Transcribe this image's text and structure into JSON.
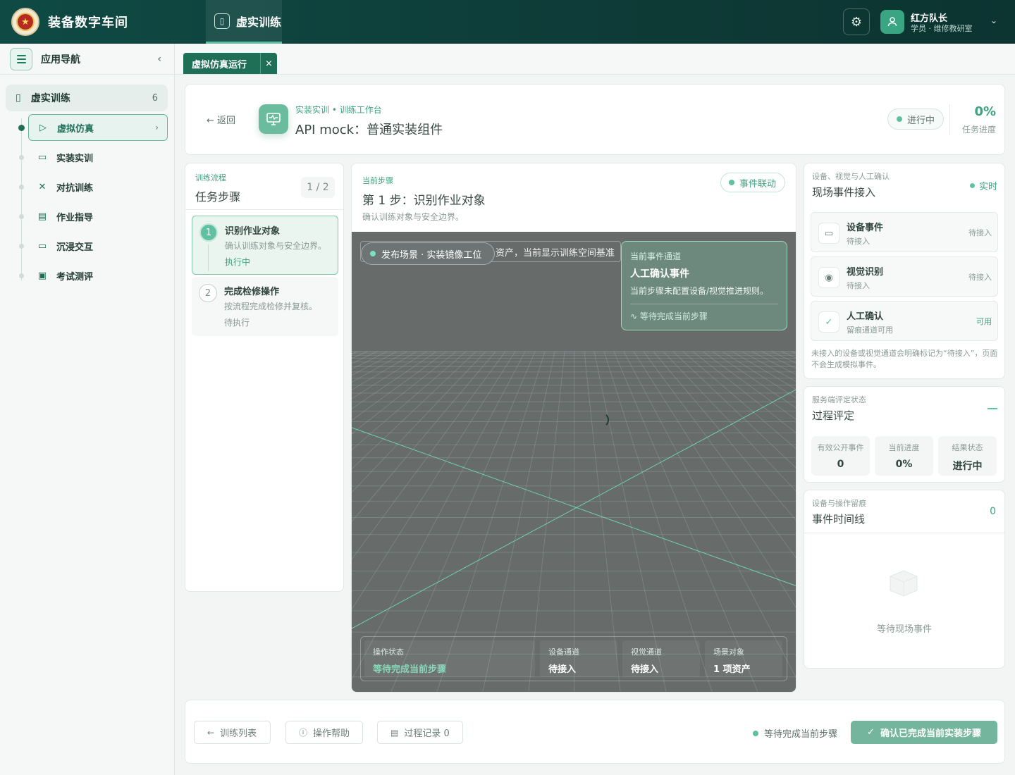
{
  "app": {
    "title": "装备数字车间",
    "logo_icon": "emblem-icon"
  },
  "topnav": {
    "label": "虚实训练"
  },
  "user": {
    "name": "红方队长",
    "subtitle": "学员 · 维修教研室"
  },
  "sidebar": {
    "title": "应用导航",
    "group": {
      "label": "虚实训练",
      "count": "6"
    },
    "items": [
      {
        "label": "虚拟仿真",
        "icon": "play-circle-icon",
        "active": true
      },
      {
        "label": "实装实训",
        "icon": "monitor-icon"
      },
      {
        "label": "对抗训练",
        "icon": "crossed-swords-icon"
      },
      {
        "label": "作业指导",
        "icon": "document-icon"
      },
      {
        "label": "沉浸交互",
        "icon": "vr-headset-icon"
      },
      {
        "label": "考试测评",
        "icon": "clipboard-check-icon"
      }
    ]
  },
  "tabs": [
    {
      "label": "虚拟仿真运行",
      "close": "×"
    }
  ],
  "header": {
    "back": "返回",
    "crumb": "实装实训 • 训练工作台",
    "title": "API mock：普通实装组件",
    "status": "进行中",
    "progress": "0%",
    "progress_label": "任务进度"
  },
  "flow": {
    "label": "训练流程",
    "title": "任务步骤",
    "counter": "1 / 2",
    "steps": [
      {
        "num": "1",
        "title": "识别作业对象",
        "desc": "确认训练对象与安全边界。",
        "state": "执行中"
      },
      {
        "num": "2",
        "title": "完成检修操作",
        "desc": "按流程完成检修并复核。",
        "state": "待执行"
      }
    ]
  },
  "main": {
    "label": "当前步骤",
    "title": "第 1 步：识别作业对象",
    "sub": "确认训练对象与安全边界。",
    "badge": "事件联动",
    "scene_banner": "资产，当前显示训练空间基准",
    "scene_pill": "发布场景 · 实装镜像工位",
    "event_card": {
      "label": "当前事件通道",
      "title": "人工确认事件",
      "desc": "当前步骤未配置设备/视觉推进规则。",
      "action": "等待完成当前步骤"
    },
    "status_bar": [
      {
        "key": "操作状态",
        "value": "等待完成当前步骤"
      },
      {
        "key": "设备通道",
        "value": "待接入"
      },
      {
        "key": "视觉通道",
        "value": "待接入"
      },
      {
        "key": "场景对象",
        "value": "1 项资产"
      }
    ]
  },
  "access": {
    "label": "设备、视觉与人工确认",
    "title": "现场事件接入",
    "live": "实时",
    "channels": [
      {
        "name": "设备事件",
        "status": "待接入",
        "right": "待接入",
        "icon": "monitor-icon"
      },
      {
        "name": "视觉识别",
        "status": "待接入",
        "right": "待接入",
        "icon": "eye-icon"
      },
      {
        "name": "人工确认",
        "status": "留痕通道可用",
        "right": "可用",
        "icon": "check-icon"
      }
    ],
    "note": "未接入的设备或视觉通道会明确标记为“待接入”，页面不会生成模拟事件。"
  },
  "evaluation": {
    "label": "服务端评定状态",
    "title": "过程评定",
    "stats": [
      {
        "key": "有效公开事件",
        "value": "0"
      },
      {
        "key": "当前进度",
        "value": "0%"
      },
      {
        "key": "结果状态",
        "value": "进行中"
      }
    ]
  },
  "timeline": {
    "label": "设备与操作留痕",
    "title": "事件时间线",
    "count": "0",
    "empty": "等待现场事件"
  },
  "footer": {
    "list": "训练列表",
    "help": "操作帮助",
    "records": "过程记录 0",
    "status": "等待完成当前步骤",
    "confirm": "确认已完成当前实装步骤"
  },
  "colors": {
    "primary": "#1f6f57",
    "accent": "#5fc1a2",
    "topbar": "#0f4a44",
    "scene": "#676b6a"
  }
}
